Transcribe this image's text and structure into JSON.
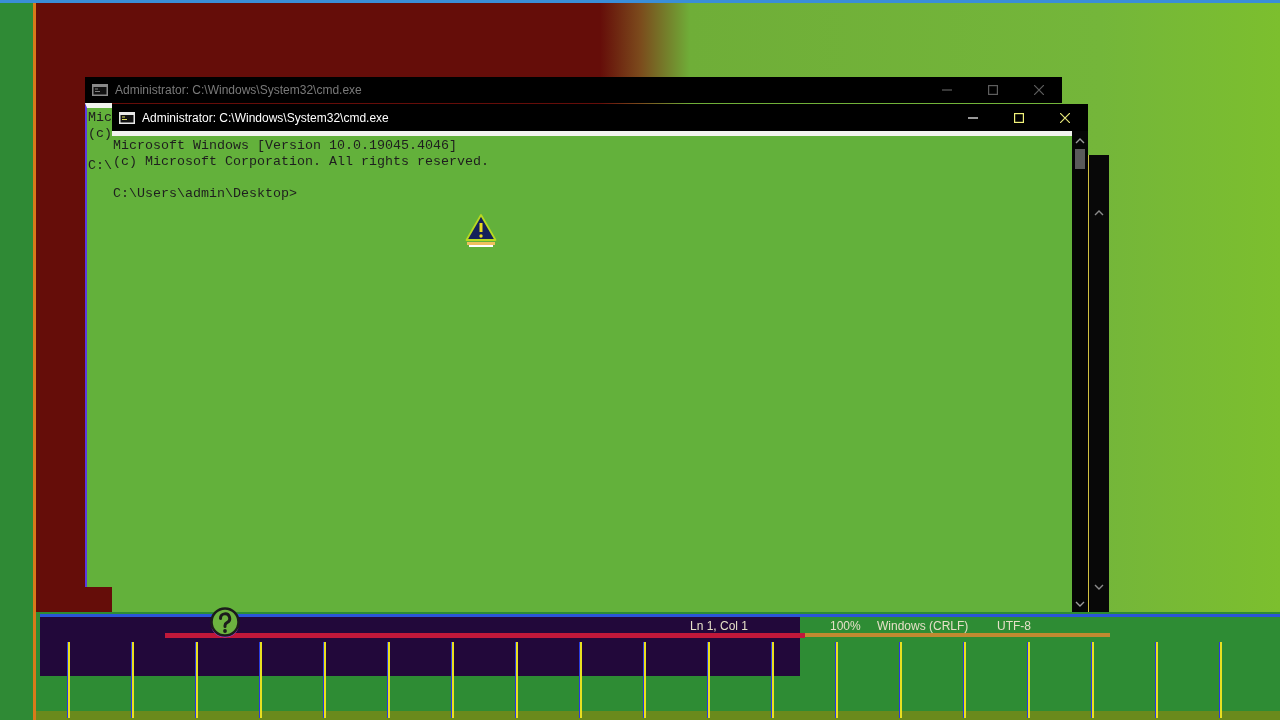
{
  "windows": [
    {
      "title": "Administrator: C:\\Windows\\System32\\cmd.exe",
      "active": false,
      "console_blocks": [
        [
          "Mic",
          "(c)"
        ],
        [
          "C:\\"
        ]
      ]
    },
    {
      "title": "Administrator: C:\\Windows\\System32\\cmd.exe",
      "active": true,
      "console_blocks": [
        [
          "Microsoft Windows [Version 10.0.19045.4046]",
          "(c) Microsoft Corporation. All rights reserved."
        ],
        [
          "C:\\Users\\admin\\Desktop>"
        ]
      ]
    }
  ],
  "status_bar": {
    "items": [
      "Ln 1, Col 1",
      "100%",
      "Windows (CRLF)",
      "UTF-8"
    ]
  }
}
